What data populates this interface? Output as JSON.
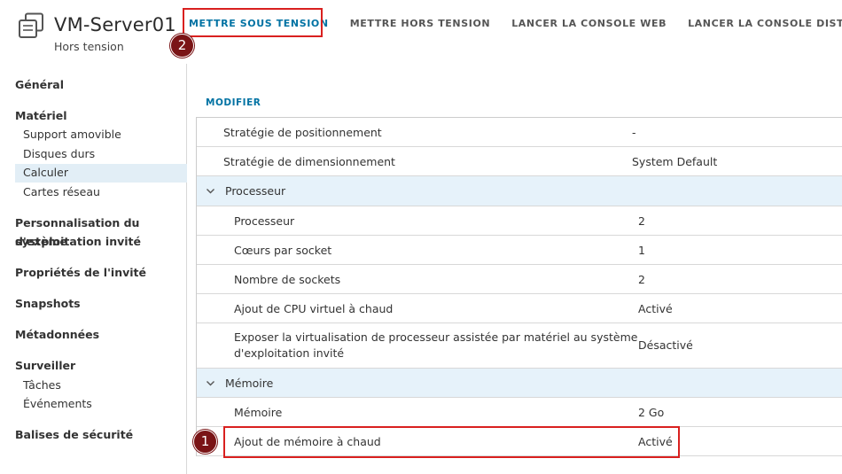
{
  "header": {
    "title": "VM-Server01",
    "status": "Hors tension",
    "actions": [
      "METTRE SOUS TENSION",
      "METTRE HORS TENSION",
      "LANCER LA CONSOLE WEB",
      "LANCER LA CONSOLE DISTANTE"
    ]
  },
  "callouts": [
    "1",
    "2"
  ],
  "sidebar": {
    "general": "Général",
    "hardware": "Matériel",
    "hardware_items": [
      "Support amovible",
      "Disques durs",
      "Calculer",
      "Cartes réseau"
    ],
    "guest_os_line1": "Personnalisation du système",
    "guest_os_line2": "d'exploitation invité",
    "guest_props": "Propriétés de l'invité",
    "snapshots": "Snapshots",
    "metadata": "Métadonnées",
    "monitor": "Surveiller",
    "monitor_items": [
      "Tâches",
      "Événements"
    ],
    "security_tags": "Balises de sécurité",
    "selected": "Calculer"
  },
  "main": {
    "modify": "MODIFIER",
    "rows": {
      "placement_label": "Stratégie de positionnement",
      "placement_value": "-",
      "sizing_label": "Stratégie de dimensionnement",
      "sizing_value": "System Default",
      "cpu_section": "Processeur",
      "cpu_label": "Processeur",
      "cpu_value": "2",
      "cores_label": "Cœurs par socket",
      "cores_value": "1",
      "sockets_label": "Nombre de sockets",
      "sockets_value": "2",
      "cpu_hotadd_label": "Ajout de CPU virtuel à chaud",
      "cpu_hotadd_value": "Activé",
      "expose_virt_line1": "Exposer la virtualisation de processeur assistée par matériel au système",
      "expose_virt_line2": "d'exploitation invité",
      "expose_virt_value": "Désactivé",
      "mem_section": "Mémoire",
      "mem_label": "Mémoire",
      "mem_value": "2 Go",
      "mem_hotadd_label": "Ajout de mémoire à chaud",
      "mem_hotadd_value": "Activé"
    }
  },
  "icons": {
    "vm": "vm-icon",
    "chevron": "chevron-down-icon"
  },
  "colors": {
    "accent": "#0072a3",
    "highlight": "#d9201f",
    "callout": "#7a1416",
    "section_bg": "#e6f2fa",
    "selected_bg": "#e2eef6"
  }
}
